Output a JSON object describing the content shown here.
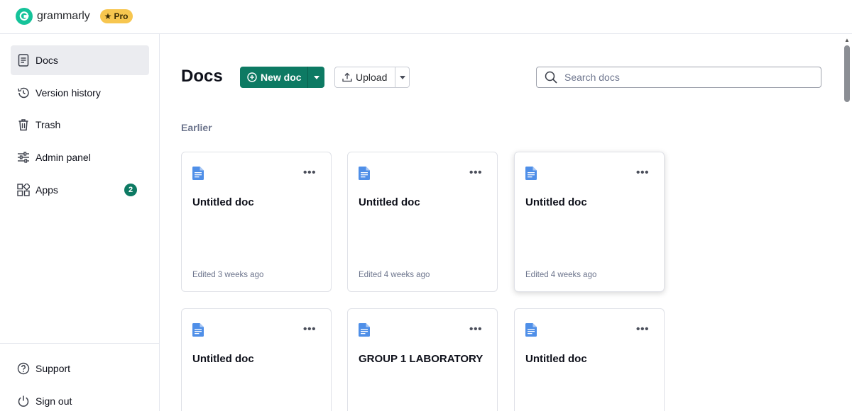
{
  "header": {
    "brand_name": "grammarly",
    "pro_badge": "Pro",
    "logo_letter": "G"
  },
  "sidebar": {
    "items": [
      {
        "label": "Docs",
        "icon": "document-icon",
        "active": true
      },
      {
        "label": "Version history",
        "icon": "history-icon"
      },
      {
        "label": "Trash",
        "icon": "trash-icon"
      },
      {
        "label": "Admin panel",
        "icon": "sliders-icon"
      },
      {
        "label": "Apps",
        "icon": "apps-grid-icon",
        "badge": "2"
      }
    ],
    "footer_items": [
      {
        "label": "Support",
        "icon": "help-circle-icon"
      },
      {
        "label": "Sign out",
        "icon": "power-icon"
      }
    ]
  },
  "main": {
    "title": "Docs",
    "new_doc_label": "New doc",
    "upload_label": "Upload",
    "search_placeholder": "Search docs",
    "section_label": "Earlier",
    "docs": [
      {
        "title": "Untitled doc",
        "meta": "Edited 3 weeks ago"
      },
      {
        "title": "Untitled doc",
        "meta": "Edited 4 weeks ago"
      },
      {
        "title": "Untitled doc",
        "meta": "Edited 4 weeks ago"
      },
      {
        "title": "Untitled doc",
        "meta": ""
      },
      {
        "title": "GROUP 1 LABORATORY",
        "meta": ""
      },
      {
        "title": "Untitled doc",
        "meta": ""
      }
    ]
  },
  "colors": {
    "brand_green": "#15c39a",
    "button_green": "#0d7a63",
    "pro_yellow": "#f7c64f",
    "doc_icon_blue": "#4f8fe8"
  }
}
